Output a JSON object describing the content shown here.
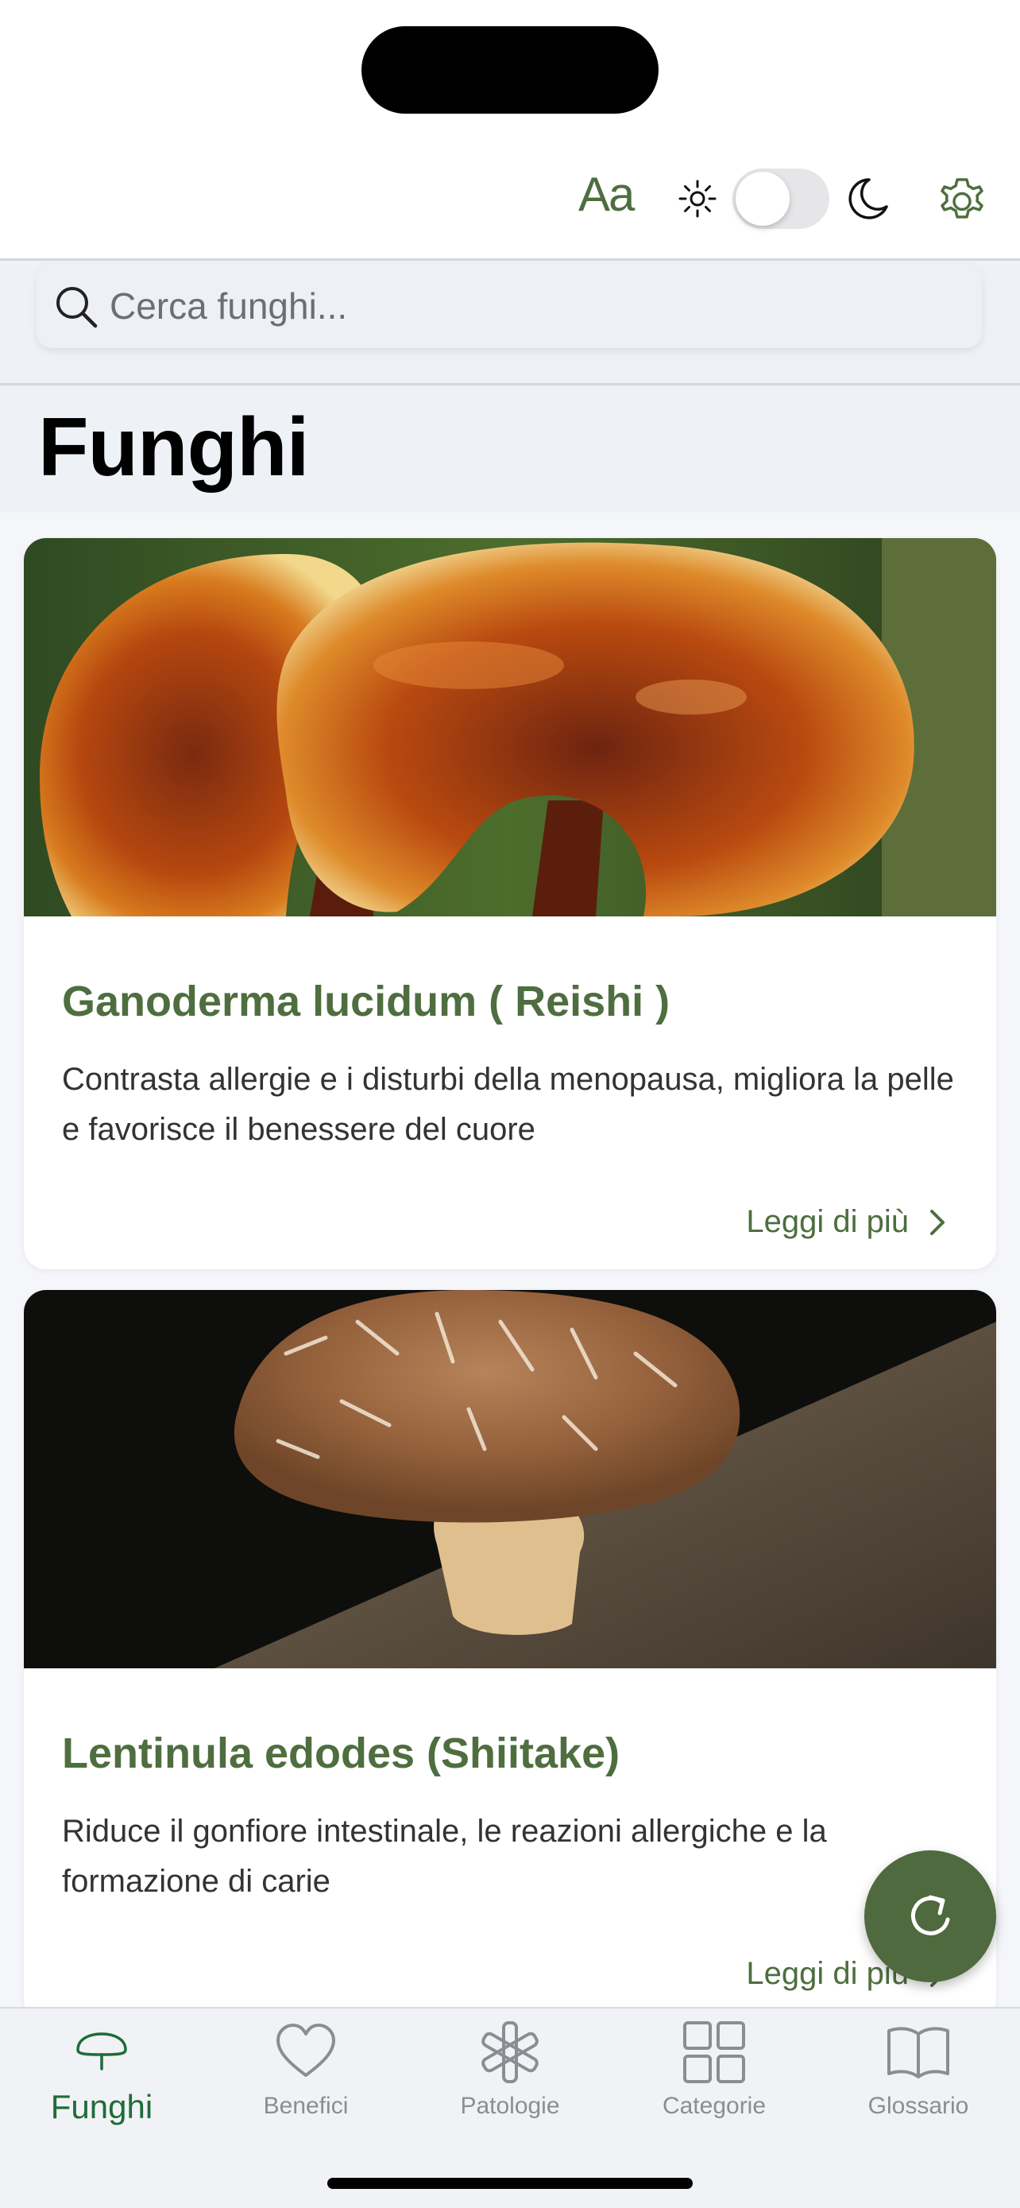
{
  "header": {
    "font_size_label": "Aa",
    "icons": [
      "sun-icon",
      "moon-icon",
      "gear-icon"
    ],
    "theme_toggle_on": false
  },
  "search": {
    "placeholder": "Cerca funghi..."
  },
  "page": {
    "title": "Funghi"
  },
  "cards": [
    {
      "title": "Ganoderma lucidum ( Reishi )",
      "description": "Contrasta allergie e i disturbi della menopausa, migliora la pelle e favorisce il benessere del cuore",
      "link_label": "Leggi di più"
    },
    {
      "title": "Lentinula edodes (Shiitake)",
      "description": "Riduce il gonfiore intestinale, le reazioni allergiche e la formazione di carie",
      "link_label": "Leggi di più"
    }
  ],
  "fab": {
    "icon": "refresh-icon"
  },
  "tabs": [
    {
      "label": "Funghi",
      "icon": "mushroom-icon",
      "active": true
    },
    {
      "label": "Benefici",
      "icon": "heart-icon",
      "active": false
    },
    {
      "label": "Patologie",
      "icon": "medical-star-icon",
      "active": false
    },
    {
      "label": "Categorie",
      "icon": "grid-icon",
      "active": false
    },
    {
      "label": "Glossario",
      "icon": "book-icon",
      "active": false
    }
  ],
  "colors": {
    "accent": "#4e6e3f",
    "active_tab": "#1f6b3a",
    "inactive_tab": "#8a8d92"
  }
}
